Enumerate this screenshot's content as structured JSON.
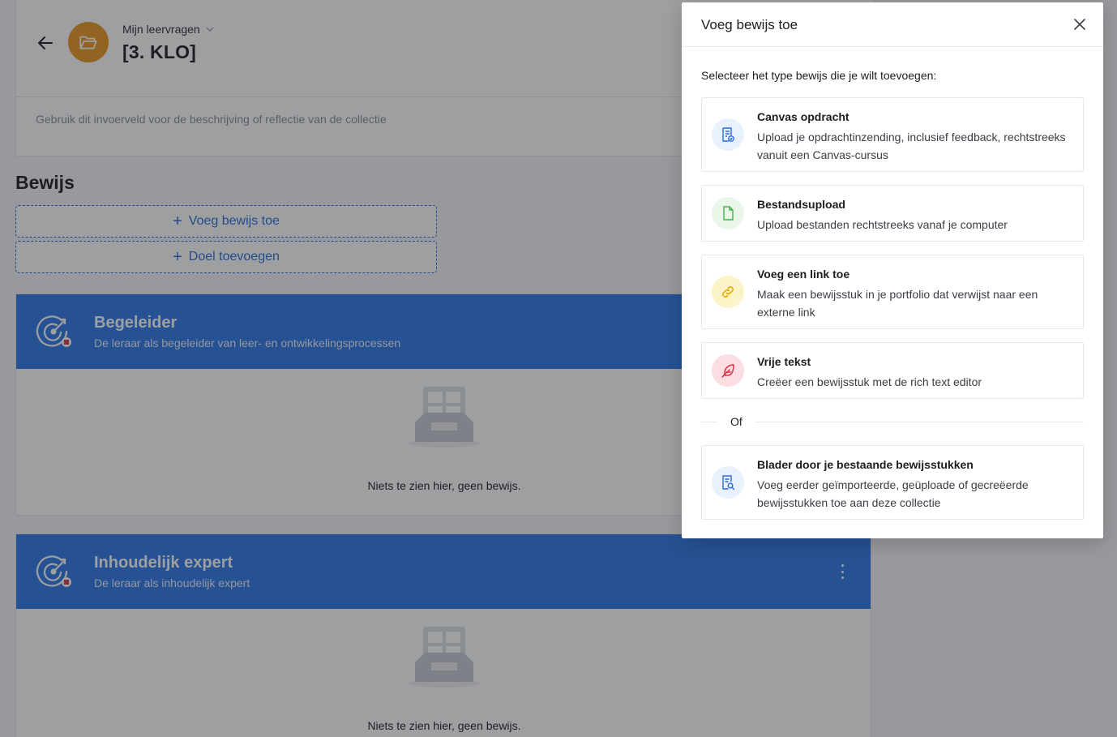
{
  "header": {
    "breadcrumb": "Mijn leervragen",
    "title": "[3. KLO]",
    "description_placeholder": "Gebruik dit invoerveld voor de beschrijving of reflectie van de collectie"
  },
  "evidence": {
    "section_title": "Bewijs",
    "add_evidence_label": "Voeg bewijs toe",
    "add_goal_label": "Doel toevoegen"
  },
  "goals": [
    {
      "name": "Begeleider",
      "subtitle": "De leraar als begeleider van leer- en ontwikkelingsprocessen",
      "empty_text": "Niets te zien hier, geen bewijs."
    },
    {
      "name": "Inhoudelijk expert",
      "subtitle": "De leraar als inhoudelijk expert",
      "empty_text": "Niets te zien hier, geen bewijs."
    }
  ],
  "modal": {
    "title": "Voeg bewijs toe",
    "intro": "Selecteer het type bewijs die je wilt toevoegen:",
    "options": [
      {
        "icon": "canvas-assignment-icon",
        "title": "Canvas opdracht",
        "description": "Upload je opdrachtinzending, inclusief feedback, rechtstreeks vanuit een Canvas-cursus",
        "color": "#2b6cd6",
        "bg": "#e8f1fd"
      },
      {
        "icon": "file-icon",
        "title": "Bestandsupload",
        "description": "Upload bestanden rechtstreeks vanaf je computer",
        "color": "#43b14a",
        "bg": "#eaf6ea"
      },
      {
        "icon": "link-icon",
        "title": "Voeg een link toe",
        "description": "Maak een bewijsstuk in je portfolio dat verwijst naar een externe link",
        "color": "#e6a800",
        "bg": "#fdf3c8"
      },
      {
        "icon": "feather-icon",
        "title": "Vrije tekst",
        "description": "Creëer een bewijsstuk met de rich text editor",
        "color": "#d8324a",
        "bg": "#fbdde2"
      }
    ],
    "or_label": "Of",
    "browse": {
      "icon": "search-document-icon",
      "title": "Blader door je bestaande bewijsstukken",
      "description": "Voeg eerder geïmporteerde, geüploade of gecreëerde bewijsstukken toe aan deze collectie",
      "color": "#2b6cd6",
      "bg": "#e8f1fd"
    }
  }
}
